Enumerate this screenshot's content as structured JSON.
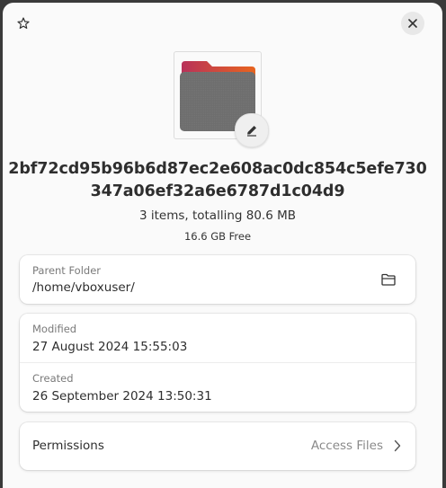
{
  "header": {
    "star_icon": "star-icon",
    "close_icon": "close-icon"
  },
  "folder": {
    "icon": "folder-icon",
    "edit_icon": "pencil-icon",
    "colors": {
      "tab_from": "#b8325a",
      "tab_to": "#e8641e",
      "body": "#6f6f6f"
    },
    "name_line1": "2bf72cd95b96b6d87ec2e608ac0dc854c5efe730",
    "name_line2": "347a06ef32a6e6787d1c04d9",
    "summary": "3 items, totalling 80.6 MB",
    "free_space": "16.6 GB Free"
  },
  "parent": {
    "label": "Parent Folder",
    "value": "/home/vboxuser/",
    "open_icon": "folder-open-icon"
  },
  "dates": {
    "modified_label": "Modified",
    "modified_value": "27 August 2024 15:55:03",
    "created_label": "Created",
    "created_value": "26 September 2024 13:50:31"
  },
  "permissions": {
    "label": "Permissions",
    "value": "Access Files",
    "chevron_icon": "chevron-right-icon"
  }
}
